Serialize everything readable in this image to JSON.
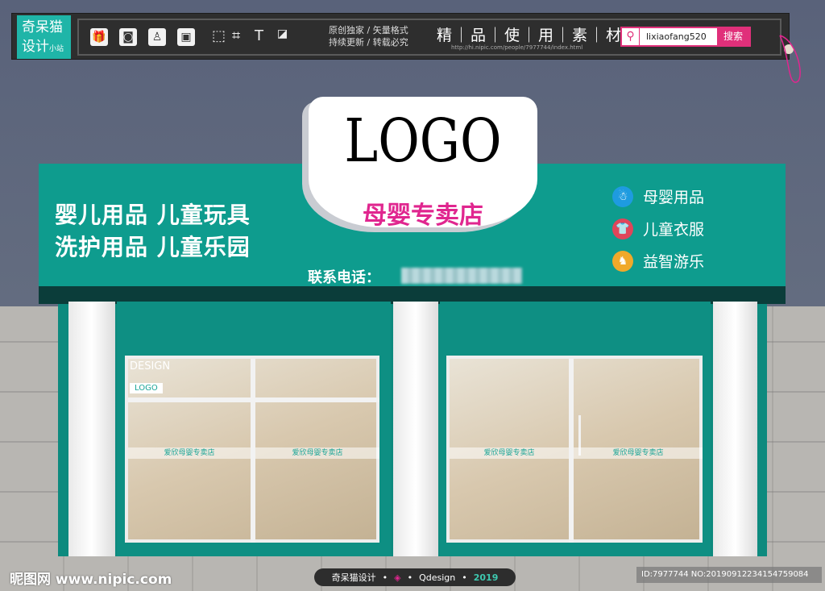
{
  "topbar": {
    "brand": "奇呆猫设计",
    "brand_sub": "小站",
    "slogan1": "原创独家 / 矢量格式",
    "slogan2": "持续更新 / 转载必究",
    "headline": "精｜品｜使｜用｜素｜材",
    "url": "http://hi.nipic.com/people/7977744/index.html",
    "search_value": "lixiaofang520",
    "search_button": "搜索"
  },
  "sign": {
    "logo": "LOGO",
    "shop_name": "母婴专卖店",
    "slogans": [
      "婴儿用品  儿童玩具",
      "洗护用品  儿童乐园"
    ],
    "phone_label": "联系电话：",
    "features": [
      {
        "label": "母婴用品",
        "color": "#1e9be0"
      },
      {
        "label": "儿童衣服",
        "color": "#e0455a"
      },
      {
        "label": "益智游乐",
        "color": "#f0a92a"
      }
    ]
  },
  "windows": {
    "band_text": "爱欣母婴专卖店",
    "design_text": "DESIGN",
    "inner_logo": "LOGO"
  },
  "footer": {
    "site": "昵图网 www.nipic.com",
    "pill": [
      "奇呆猫设计",
      "Qdesign",
      "2019"
    ],
    "id": "ID:7977744 NO:20190912234154759084"
  },
  "colors": {
    "teal": "#0e9c8e",
    "pink": "#e0268f",
    "bar": "#2e2e2e"
  }
}
